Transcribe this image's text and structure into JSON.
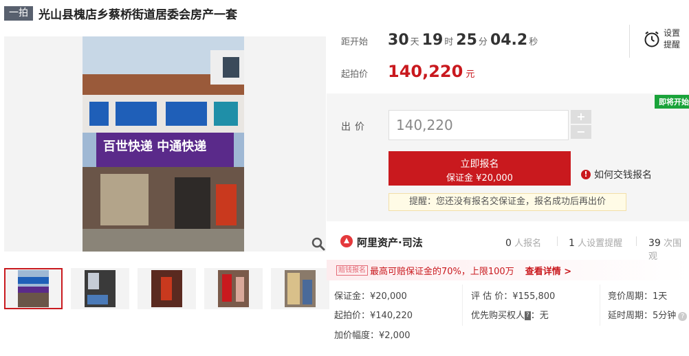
{
  "title": {
    "tag": "一拍",
    "text": "光山县槐店乡蔡桥街道居委会房产一套"
  },
  "countdown": {
    "label": "距开始",
    "days": "30",
    "days_unit": "天",
    "hours": "19",
    "hours_unit": "时",
    "minutes": "25",
    "minutes_unit": "分",
    "seconds": "04.2",
    "seconds_unit": "秒"
  },
  "start_price": {
    "label": "起拍价",
    "value": "140,220",
    "unit": "元"
  },
  "reminder": {
    "line1": "设置",
    "line2": "提醒"
  },
  "bid": {
    "badge": "即将开始",
    "label": "出价",
    "input_value": "140,220",
    "plus": "+",
    "minus": "−",
    "signup_line1": "立即报名",
    "signup_line2": "保证金 ¥20,000",
    "howto_label": "如何交钱报名",
    "notice": "提醒：您还没有报名交保证金，报名成功后再出价"
  },
  "platform": {
    "name": "阿里资产·司法",
    "signups_count": "0",
    "signups_label": "人报名",
    "reminders_count": "1",
    "reminders_label": "人设置提醒",
    "views_count": "39",
    "views_label": "次围观"
  },
  "compensation": {
    "tag": "赔钱报名",
    "text": "最高可赔保证金的70%，上限100万",
    "link": "查看详情 >"
  },
  "details": {
    "deposit": "保证金：¥20,000",
    "start_price": "起拍价：¥140,220",
    "increment": "加价幅度：¥2,000",
    "appraisal": "评 估 价：¥155,800",
    "priority_label": "优先购买权人",
    "priority_badge": "?",
    "priority_value": "：无",
    "cycle": "竞价周期：1天",
    "delay": "延时周期：5分钟"
  },
  "colors": {
    "accent": "#c9191e",
    "badge_green": "#1aa33a",
    "tag_gray": "#58606e"
  }
}
